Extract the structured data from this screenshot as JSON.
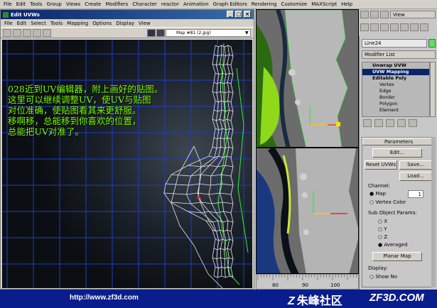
{
  "main_menu": [
    "File",
    "Edit",
    "Tools",
    "Group",
    "Views",
    "Create",
    "Modifiers",
    "Character",
    "reactor",
    "Animation",
    "Graph Editors",
    "Rendering",
    "Customize",
    "MAXScript",
    "Help"
  ],
  "uvw_window": {
    "title": "Edit UVWs",
    "menu": [
      "File",
      "Edit",
      "Select",
      "Tools",
      "Mapping",
      "Options",
      "Display",
      "View"
    ],
    "map_dropdown": "Map #81 (2.jpg)",
    "overlay_text": [
      "028近到UV编辑器，附上画好的贴图。",
      "这里可以继续调整UV，使UV与贴图",
      "对位准确，使贴图看其来更舒服。",
      "移啊移，总能移到你喜欢的位置，",
      "总能把UV对准了。"
    ]
  },
  "viewport_toolbar": {
    "view_label": "View"
  },
  "command_panel": {
    "object_name": "Line24",
    "modifier_list": "Modifier List",
    "stack": [
      {
        "label": "Unwrap UVW",
        "level": 0
      },
      {
        "label": "UVW Mapping",
        "level": 0
      },
      {
        "label": "Editable Poly",
        "level": 0
      },
      {
        "label": "Vertex",
        "level": 1
      },
      {
        "label": "Edge",
        "level": 1
      },
      {
        "label": "Border",
        "level": 1
      },
      {
        "label": "Polygon",
        "level": 1
      },
      {
        "label": "Element",
        "level": 1
      }
    ],
    "parameters_title": "Parameters",
    "edit_button": "Edit...",
    "reset_uvws_button": "Reset UVWs",
    "save_button": "Save...",
    "load_button": "Load...",
    "channel_label": "Channel:",
    "map_radio": "Map",
    "map_channel_value": "1",
    "vertex_color_radio": "Vertex Color",
    "sub_object_label": "Sub Object Params:",
    "axis_x": "X",
    "axis_y": "Y",
    "axis_z": "Z",
    "axis_averaged": "Averaged",
    "planar_map_button": "Planar Map",
    "display_label": "Display:",
    "show_no_label": "Show No"
  },
  "ruler": {
    "ticks": [
      "80",
      "90",
      "100"
    ]
  },
  "banner": {
    "url": "http://www.zf3d.com",
    "logo_text": "朱峰社区",
    "site": "ZF3D.COM"
  },
  "colors": {
    "overlay_text": "#7cfc00",
    "uv_grid": "#1e3cc8",
    "banner": "#0a1d8c"
  }
}
